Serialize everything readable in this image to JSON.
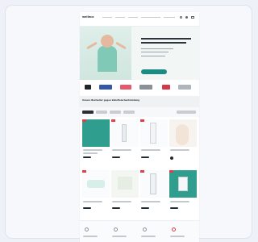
{
  "colors": {
    "accent": "#1c8b83",
    "brand_red": "#e23c49",
    "hero_bg": "#f2f7f5"
  },
  "header": {
    "logo": "welleco"
  },
  "section": {
    "title": "Unsere Bestseller gegen Zahnfleischentzündung"
  },
  "icons": [
    "search-icon",
    "user-icon",
    "cart-icon",
    "menu-icon"
  ]
}
